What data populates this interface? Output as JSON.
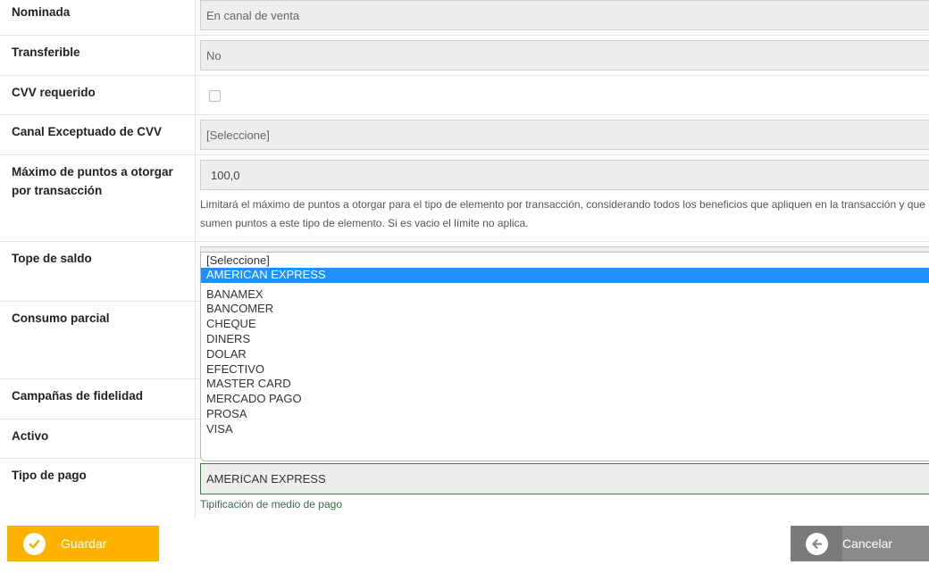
{
  "fields": {
    "nominada": {
      "label": "Nominada",
      "value": "En canal de venta"
    },
    "transferible": {
      "label": "Transferible",
      "value": "No"
    },
    "cvv_requerido": {
      "label": "CVV requerido"
    },
    "canal_exceptuado": {
      "label": "Canal Exceptuado de CVV",
      "value": "[Seleccione]"
    },
    "maximo_puntos": {
      "label_line1": "Máximo de puntos a otorgar",
      "label_line2": "por transacción",
      "value": "100,0",
      "help_line1": "Limitará el máximo de puntos a otorgar para el tipo de elemento por transacción, considerando todos los beneficios que apliquen en la transacción y que",
      "help_line2": "sumen puntos a este tipo de elemento. Si es vacio el límite no aplica."
    },
    "tope_saldo": {
      "label": "Tope de saldo"
    },
    "consumo_parcial": {
      "label": "Consumo parcial"
    },
    "campanas": {
      "label": "Campañas de fidelidad"
    },
    "activo": {
      "label": "Activo"
    },
    "tipo_pago": {
      "label": "Tipo de pago",
      "value": "AMERICAN EXPRESS",
      "help": "Tipificación de medio de pago"
    }
  },
  "dropdown": {
    "options": [
      "[Seleccione]",
      "AMERICAN EXPRESS",
      "",
      "BANAMEX",
      "BANCOMER",
      "CHEQUE",
      "DINERS",
      "DOLAR",
      "EFECTIVO",
      "MASTER CARD",
      "MERCADO PAGO",
      "PROSA",
      "VISA"
    ],
    "selected": "AMERICAN EXPRESS"
  },
  "buttons": {
    "save": "Guardar",
    "cancel": "Cancelar"
  },
  "colors": {
    "save": "#ffb100",
    "cancel": "#8a8a8a",
    "selected_option": "#1e90ff"
  }
}
